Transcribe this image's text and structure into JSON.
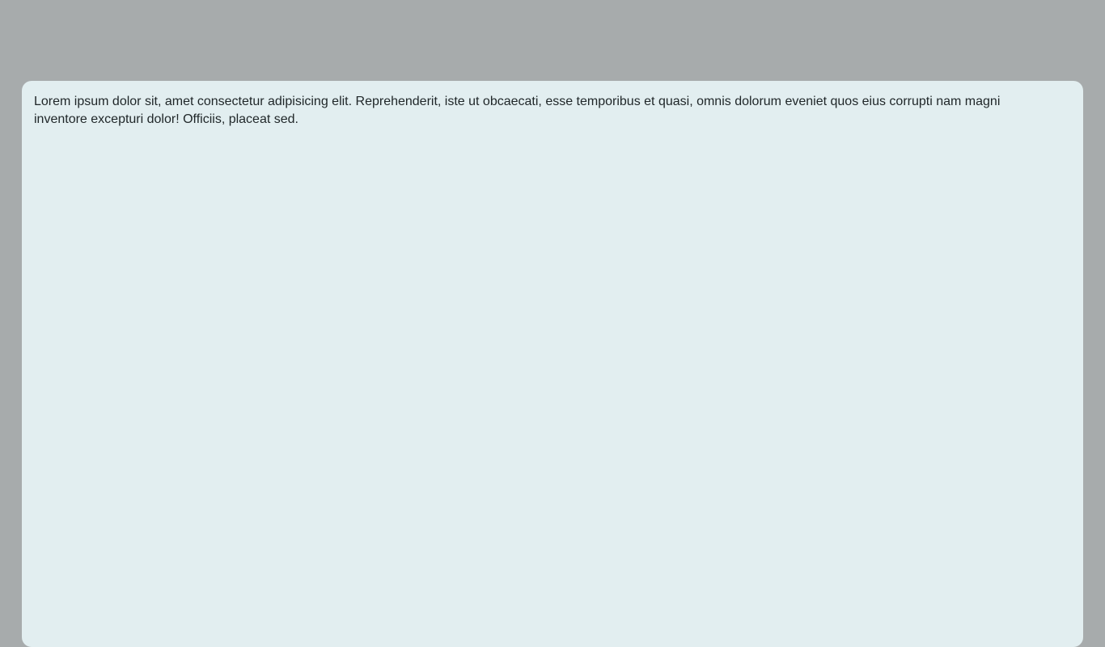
{
  "card": {
    "text": "Lorem ipsum dolor sit, amet consectetur adipisicing elit. Reprehenderit, iste ut obcaecati, esse temporibus et quasi, omnis dolorum eveniet quos eius corrupti nam magni inventore excepturi dolor! Officiis, placeat sed."
  },
  "colors": {
    "page_background": "#a7abac",
    "card_background": "#e2eef0",
    "text": "#1f2628"
  }
}
